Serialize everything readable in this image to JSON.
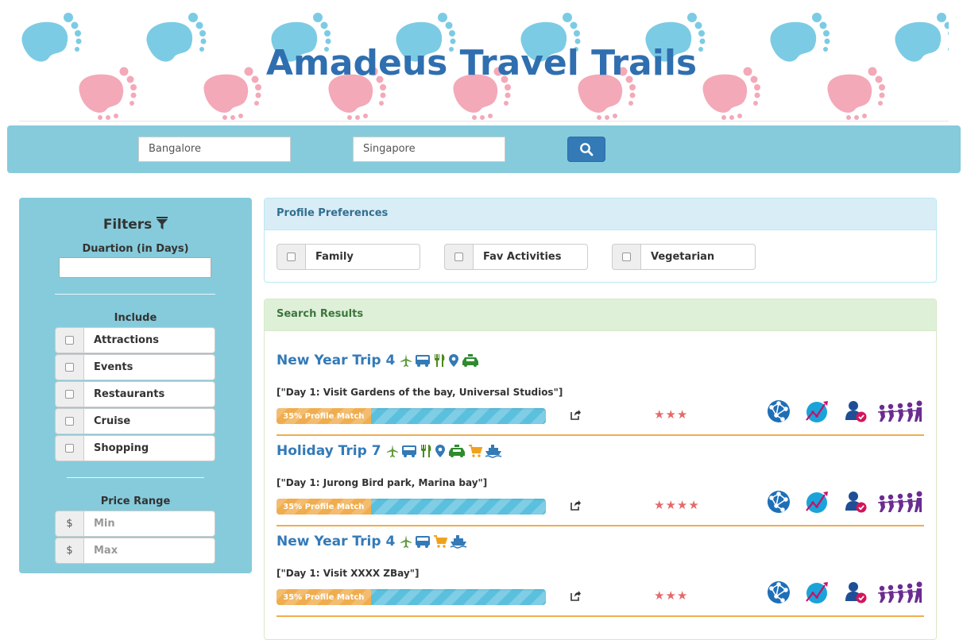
{
  "header": {
    "title": "Amadeus Travel Trails"
  },
  "search": {
    "from_value": "Bangalore",
    "to_value": "Singapore",
    "button_icon": "search-icon"
  },
  "filters": {
    "title": "Filters",
    "duration_label": "Duartion (in Days)",
    "include_label": "Include",
    "include_items": [
      "Attractions",
      "Events",
      "Restaurants",
      "Cruise",
      "Shopping"
    ],
    "price_label": "Price Range",
    "price_currency": "$",
    "price_min_placeholder": "Min",
    "price_max_placeholder": "Max"
  },
  "profile": {
    "heading": "Profile Preferences",
    "options": [
      "Family",
      "Fav Activities",
      "Vegetarian"
    ]
  },
  "results": {
    "heading": "Search Results",
    "items": [
      {
        "title": "New Year Trip 4",
        "description": "[\"Day 1: Visit Gardens of the bay, Universal Studios\"]",
        "match_label": "35% Profile Match",
        "match_percent": 35,
        "stars": "★★★",
        "rating": 3,
        "icons": [
          "plane-icon",
          "bus-icon",
          "restaurant-icon",
          "map-marker-icon",
          "taxi-icon"
        ]
      },
      {
        "title": "Holiday Trip 7",
        "description": "[\"Day 1: Jurong Bird park, Marina bay\"]",
        "match_label": "35% Profile Match",
        "match_percent": 35,
        "stars": "★★★★",
        "rating": 4,
        "icons": [
          "plane-icon",
          "bus-icon",
          "restaurant-icon",
          "map-marker-icon",
          "taxi-icon",
          "shopping-cart-icon",
          "cruise-icon"
        ]
      },
      {
        "title": "New Year Trip 4",
        "description": "[\"Day 1: Visit XXXX ZBay\"]",
        "match_label": "35% Profile Match",
        "match_percent": 35,
        "stars": "★★★",
        "rating": 3,
        "icons": [
          "plane-icon",
          "bus-icon",
          "shopping-cart-icon",
          "cruise-icon"
        ]
      }
    ]
  },
  "colors": {
    "brand_blue": "#2f6fb0",
    "search_bar": "#86cbdb",
    "progress_warning": "#f0ad4e",
    "progress_info": "#5bc0de",
    "stars": "#e46a6a"
  }
}
